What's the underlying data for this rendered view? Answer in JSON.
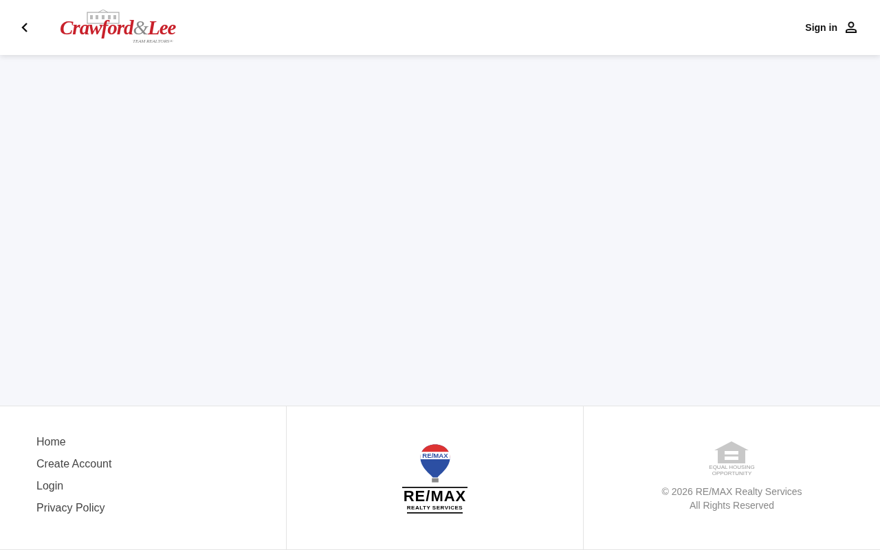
{
  "header": {
    "logo": {
      "name_1": "Crawford",
      "ampersand": "&",
      "name_2": "Lee",
      "tagline": "TEAM REALTORS®"
    },
    "sign_in": "Sign in"
  },
  "footer": {
    "links": [
      "Home",
      "Create Account",
      "Login",
      "Privacy Policy"
    ],
    "brand": {
      "balloon_text": "RE/MAX",
      "wordmark": "RE/MAX",
      "subtitle": "REALTY SERVICES"
    },
    "housing": {
      "line_1": "EQUAL HOUSING",
      "line_2": "OPPORTUNITY"
    },
    "copyright": "© 2026 RE/MAX Realty Services",
    "rights": "All Rights Reserved"
  }
}
